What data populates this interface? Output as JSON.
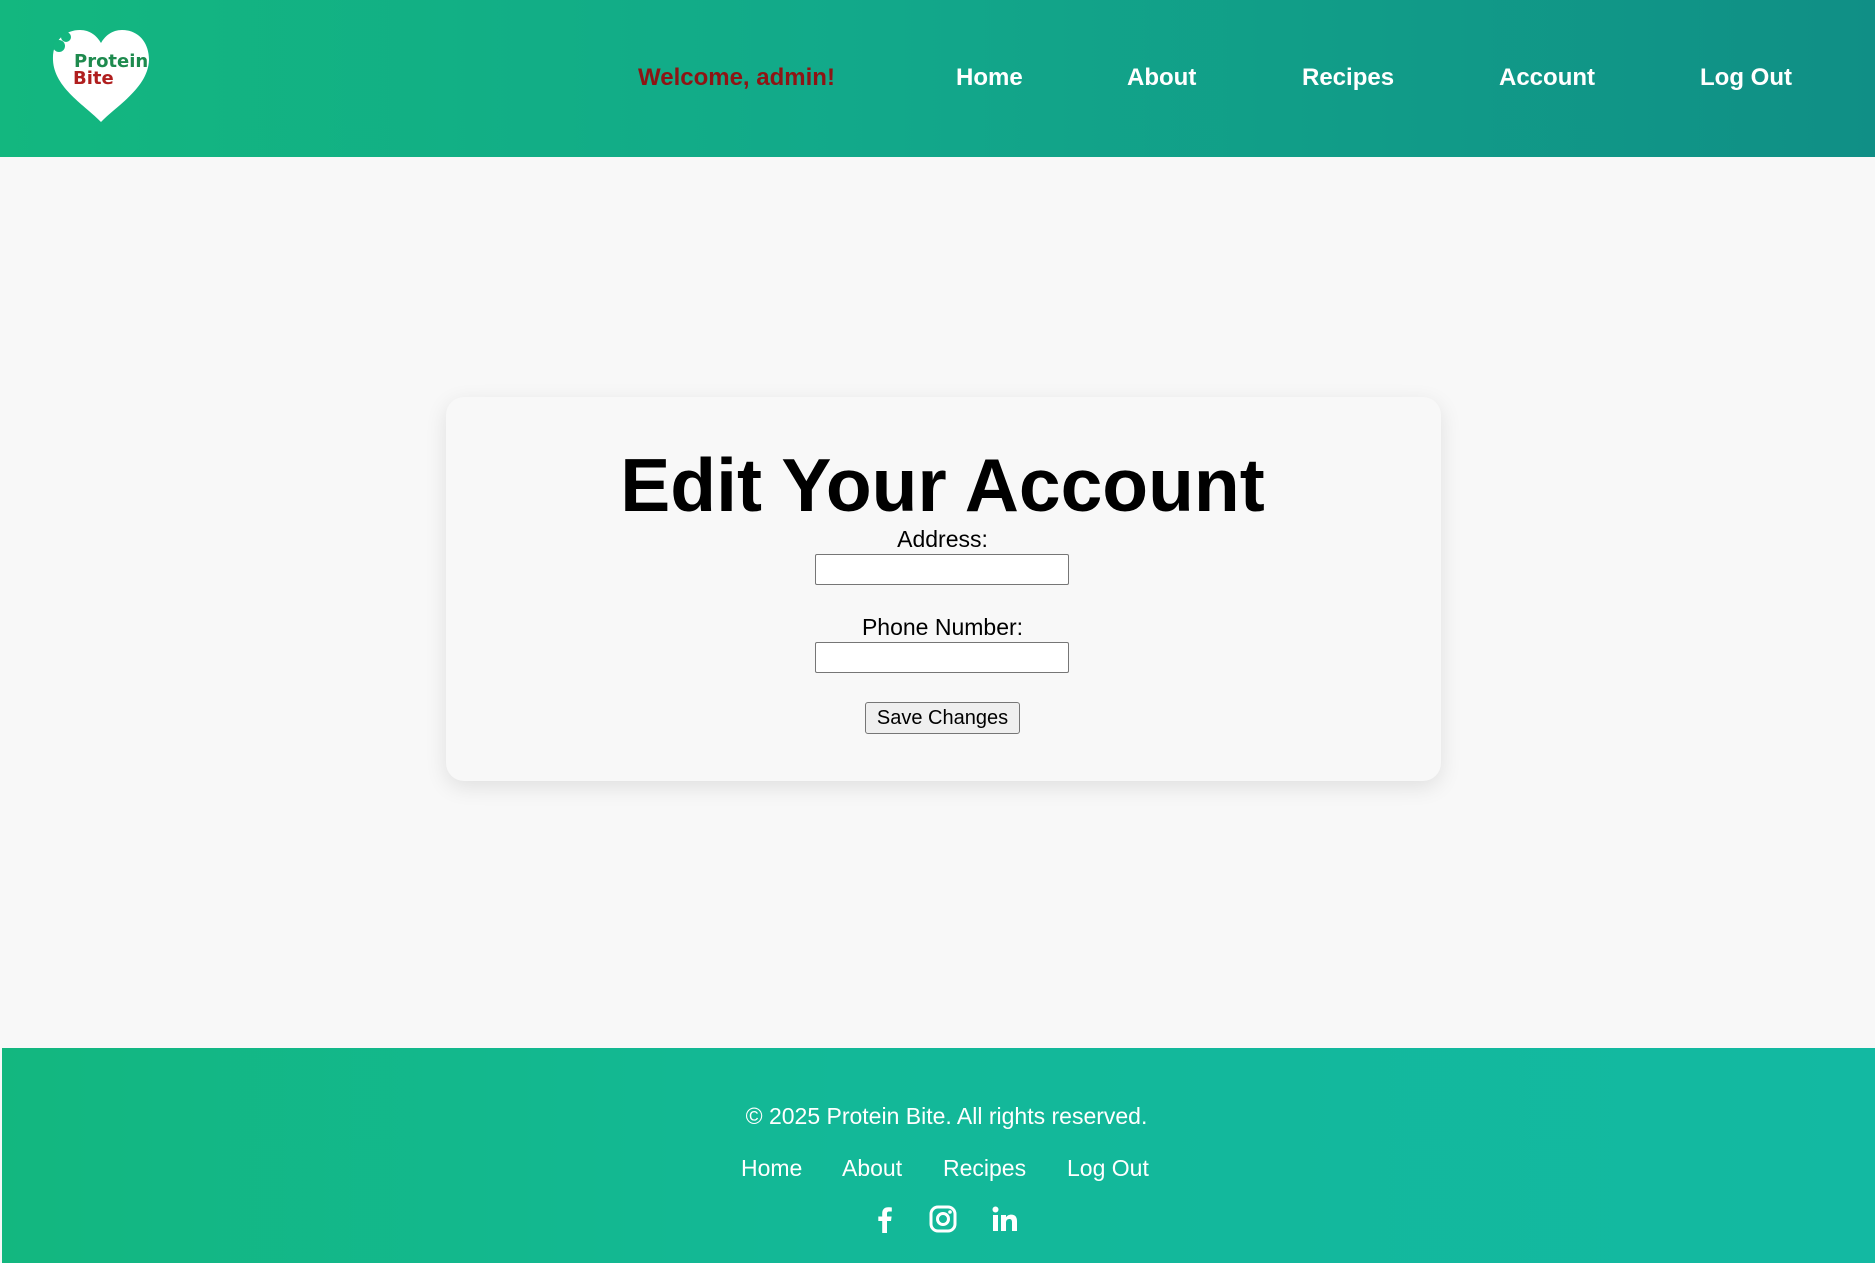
{
  "header": {
    "logo": {
      "line1": "Protein",
      "line2": "Bite",
      "colors": {
        "heart": "#ffffff",
        "line1": "#1e8a4e",
        "line2": "#b01e1e"
      }
    },
    "welcome": "Welcome, admin!",
    "nav": [
      "Home",
      "About",
      "Recipes",
      "Account",
      "Log Out"
    ]
  },
  "main": {
    "title": "Edit Your Account",
    "fields": [
      {
        "label": "Address:",
        "value": ""
      },
      {
        "label": "Phone Number:",
        "value": ""
      }
    ],
    "save_label": "Save Changes"
  },
  "footer": {
    "copyright": "© 2025 Protein Bite. All rights reserved.",
    "links": [
      "Home",
      "About",
      "Recipes",
      "Log Out"
    ],
    "social_icons": [
      "facebook-icon",
      "instagram-icon",
      "linkedin-icon"
    ]
  },
  "colors": {
    "header_gradient": [
      "#13b77f",
      "#108f86"
    ],
    "footer_gradient": [
      "#13b77f",
      "#13b9a2"
    ],
    "welcome_text": "#8e1414",
    "background": "#f8f8f8"
  }
}
